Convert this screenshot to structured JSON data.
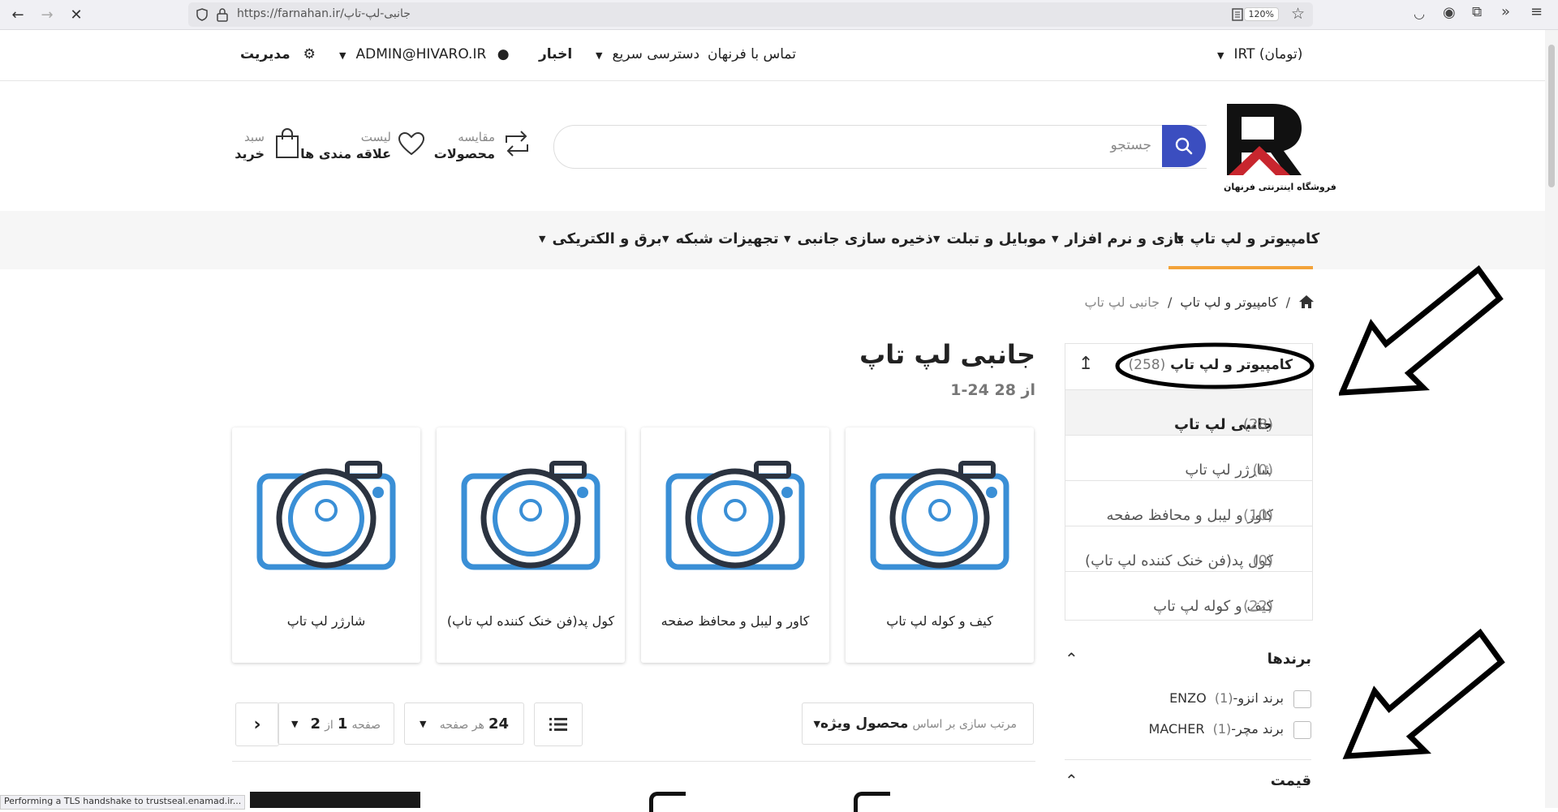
{
  "browser": {
    "url": "https://farnahan.ir/جانبی-لپ-تاپ",
    "zoom": "120%",
    "status_text": "Performing a TLS handshake to trustseal.enamad.ir..."
  },
  "topbar": {
    "currency": "IRT (تومان)",
    "contact": "تماس با فرنهان",
    "quick_access": "دسترسی سریع",
    "news": "اخبار",
    "user_email": "ADMIN@HIVARO.IR",
    "admin": "مدیریت"
  },
  "header": {
    "logo_text": "فروشگاه اینترنتی فرنهان",
    "search_placeholder": "جستجو",
    "compare_small": "مقایسه",
    "compare_big": "محصولات",
    "wishlist_small": "لیست",
    "wishlist_big": "علاقه مندی ها",
    "cart_small": "سبد",
    "cart_big": "خرید"
  },
  "catnav": {
    "items": [
      {
        "label": "کامپیوتر و لپ تاپ"
      },
      {
        "label": "بازی و نرم افزار"
      },
      {
        "label": "موبایل و تبلت"
      },
      {
        "label": "ذخیره سازی جانبی"
      },
      {
        "label": "تجهیزات شبکه"
      },
      {
        "label": "برق و الکتریکی"
      }
    ]
  },
  "breadcrumb": {
    "parent": "کامپیوتر و لپ تاپ",
    "current": "جانبی لپ تاپ",
    "separator": "/"
  },
  "sidebar": {
    "parent_label": "کامپیوتر و لپ تاپ",
    "parent_count": "(258)",
    "items": [
      {
        "label": "جانبی لپ تاپ",
        "count": "(28)"
      },
      {
        "label": "شارژر لپ تاپ",
        "count": "(0)"
      },
      {
        "label": "کاور و لیبل و محافظ صفحه",
        "count": "(10)"
      },
      {
        "label": "کول پد(فن خنک کننده لپ تاپ)",
        "count": "(0)"
      },
      {
        "label": "کیف و کوله لپ تاپ",
        "count": "(22)"
      }
    ],
    "brands_title": "برندها",
    "brands": [
      {
        "label": "برند انزو-ENZO",
        "count": "(1)"
      },
      {
        "label": "برند مچر-MACHER",
        "count": "(1)"
      }
    ],
    "price_title": "قیمت"
  },
  "main": {
    "title": "جانبی لپ تاپ",
    "range": "1-24 از 28",
    "products": [
      {
        "title": "کیف و کوله لپ تاپ"
      },
      {
        "title": "کاور و لیبل و محافظ صفحه"
      },
      {
        "title": "کول پد(فن خنک کننده لپ تاپ)"
      },
      {
        "title": "شارژر لپ تاپ"
      }
    ],
    "toolbar": {
      "sort_label": "مرتب سازی بر اساس",
      "sort_value": "محصول ویژه",
      "per_page_value": "24",
      "per_page_label": "هر صفحه",
      "page_label": "صفحه",
      "page_value": "1",
      "page_of": "از",
      "page_total": "2"
    }
  },
  "colors": {
    "accent": "#f3a33a",
    "search_button": "#3b4ec0",
    "camera_blue": "#3a8fd6",
    "camera_dark": "#2b3340",
    "logo_red": "#c8262e"
  }
}
